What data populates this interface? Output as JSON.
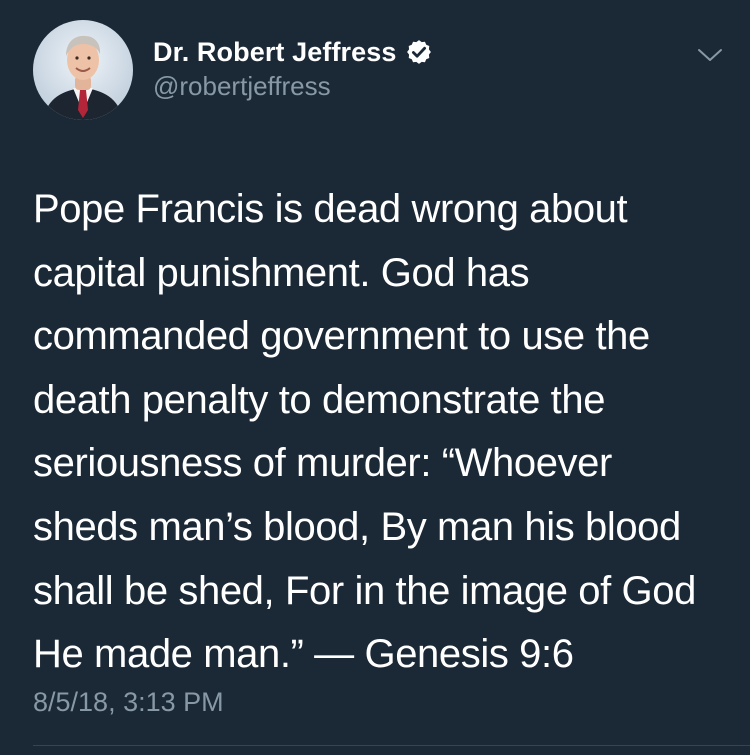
{
  "tweet": {
    "author": {
      "display_name": "Dr. Robert Jeffress",
      "handle": "@robertjeffress",
      "verified": true,
      "avatar_icon": "profile-photo"
    },
    "text": "Pope Francis is dead wrong about\ncapital punishment. God has\ncommanded government to use the\ndeath penalty to demonstrate the\nseriousness of murder: “Whoever\nsheds man’s blood, By man his blood\nshall be shed, For in the image of God\nHe made man.” — Genesis 9:6",
    "timestamp": "8/5/18, 3:13 PM",
    "menu_icon": "chevron-down-icon"
  },
  "colors": {
    "background": "#1b2836",
    "text_primary": "#ffffff",
    "text_secondary": "#8899a6",
    "verified_badge": "#ffffff",
    "divider": "#38444d"
  }
}
